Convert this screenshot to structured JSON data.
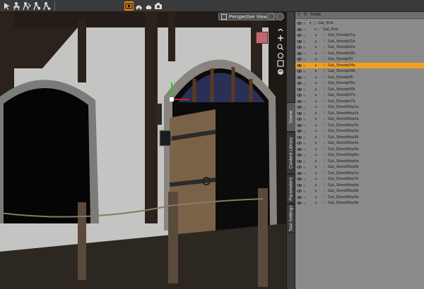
{
  "viewport": {
    "camera_label": "Perspective View"
  },
  "side_tabs": [
    {
      "label": "Scene",
      "active": true
    },
    {
      "label": "Content Library",
      "active": false
    },
    {
      "label": "Parameters",
      "active": false
    },
    {
      "label": "Tool Settings",
      "active": false
    }
  ],
  "scene_panel": {
    "header": {
      "col_visible": "V",
      "col_select": "S",
      "col_node": "Node"
    },
    "nodes": [
      {
        "label": "Gal_Pub",
        "depth": 0,
        "expanded": true,
        "selected": false
      },
      {
        "label": "Gal_Pub",
        "depth": 1,
        "expanded": true,
        "selected": false
      },
      {
        "label": "Gal_Streetp01a",
        "depth": 2,
        "selected": false
      },
      {
        "label": "Gal_Streetp01b",
        "depth": 2,
        "selected": false
      },
      {
        "label": "Gal_Streetp02a",
        "depth": 2,
        "selected": false
      },
      {
        "label": "Gal_Streetp02b",
        "depth": 2,
        "selected": false
      },
      {
        "label": "Gal_Streetp03",
        "depth": 2,
        "selected": false
      },
      {
        "label": "Gal_Streetp04a",
        "depth": 2,
        "selected": true
      },
      {
        "label": "Gal_Streetp04b",
        "depth": 2,
        "selected": false
      },
      {
        "label": "Gal_Streetp05",
        "depth": 2,
        "selected": false
      },
      {
        "label": "Gal_Streetp06a",
        "depth": 2,
        "selected": false
      },
      {
        "label": "Gal_Streetp06b",
        "depth": 2,
        "selected": false
      },
      {
        "label": "Gal_Streetp07a",
        "depth": 2,
        "selected": false
      },
      {
        "label": "Gal_Streetp07b",
        "depth": 2,
        "selected": false
      },
      {
        "label": "Gal_StreetWsp1a",
        "depth": 2,
        "selected": false
      },
      {
        "label": "Gal_StreetWsp1b",
        "depth": 2,
        "selected": false
      },
      {
        "label": "Gal_StreetWsp2a",
        "depth": 2,
        "selected": false
      },
      {
        "label": "Gal_StreetWsp2b",
        "depth": 2,
        "selected": false
      },
      {
        "label": "Gal_StreetWsp3a",
        "depth": 2,
        "selected": false
      },
      {
        "label": "Gal_StreetWsp3b",
        "depth": 2,
        "selected": false
      },
      {
        "label": "Gal_StreetWsp4a",
        "depth": 2,
        "selected": false
      },
      {
        "label": "Gal_StreetWsp4b",
        "depth": 2,
        "selected": false
      },
      {
        "label": "Gal_StreetWsp5a",
        "depth": 2,
        "selected": false
      },
      {
        "label": "Gal_StreetWsp6a",
        "depth": 2,
        "selected": false
      },
      {
        "label": "Gal_StreetWsp6b",
        "depth": 2,
        "selected": false
      },
      {
        "label": "Gal_StreetWsp7a",
        "depth": 2,
        "selected": false
      },
      {
        "label": "Gal_StreetWsp7b",
        "depth": 2,
        "selected": false
      },
      {
        "label": "Gal_StreetWsp8a",
        "depth": 2,
        "selected": false
      },
      {
        "label": "Gal_StreetWsp8b",
        "depth": 2,
        "selected": false
      },
      {
        "label": "Gal_StreetWsp9a",
        "depth": 2,
        "selected": false
      },
      {
        "label": "Gal_StreetWsp9b",
        "depth": 2,
        "selected": false
      }
    ]
  },
  "colors": {
    "selection": "#f0a020",
    "panel_bg": "#8a8a8a",
    "toolbar_bg": "#3a3a3a"
  }
}
